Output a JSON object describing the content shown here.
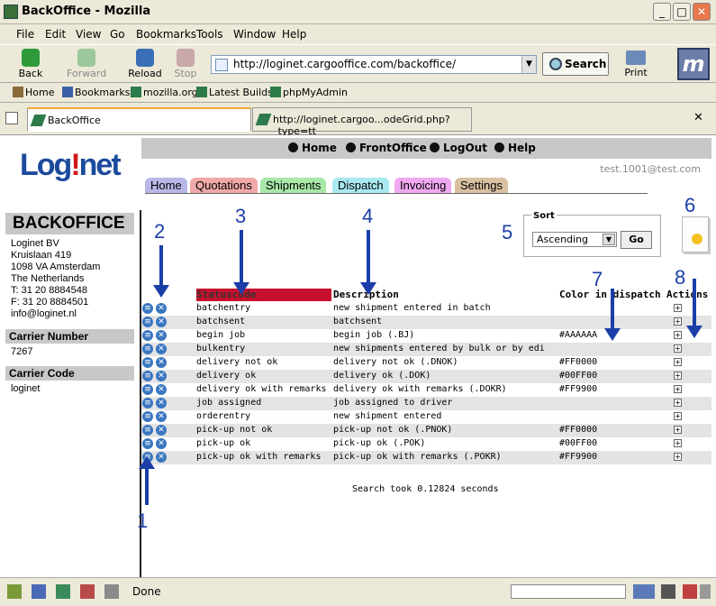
{
  "window": {
    "title": "BackOffice - Mozilla"
  },
  "menu": [
    "File",
    "Edit",
    "View",
    "Go",
    "Bookmarks",
    "Tools",
    "Window",
    "Help"
  ],
  "nav": {
    "back": "Back",
    "forward": "Forward",
    "reload": "Reload",
    "stop": "Stop",
    "print": "Print",
    "search": "Search",
    "url": "http://loginet.cargooffice.com/backoffice/"
  },
  "bookmarks": [
    "Home",
    "Bookmarks",
    "mozilla.org",
    "Latest Builds",
    "phpMyAdmin"
  ],
  "tabs": [
    "BackOffice",
    "http://loginet.cargoo...odeGrid.php?_type=tt"
  ],
  "status": {
    "text": "Done"
  },
  "app": {
    "logo_a": "Log",
    "logo_b": "!",
    "logo_c": "net",
    "topnav": [
      "Home",
      "FrontOffice",
      "LogOut",
      "Help"
    ],
    "email": "test.1001@test.com",
    "tabs": [
      {
        "label": "Home",
        "color": "#b8b8e8"
      },
      {
        "label": "Quotations",
        "color": "#f0a8a8"
      },
      {
        "label": "Shipments",
        "color": "#a8e8a8"
      },
      {
        "label": "Dispatch",
        "color": "#a8e8f0"
      },
      {
        "label": "Invoicing",
        "color": "#f0a8f0"
      },
      {
        "label": "Settings",
        "color": "#d8c0a0"
      }
    ],
    "backoffice": {
      "title": "BACKOFFICE",
      "address": [
        "Loginet BV",
        "Kruislaan 419",
        "1098 VA Amsterdam",
        "The Netherlands",
        "T: 31 20 8884548",
        "F: 31 20 8884501",
        "info@loginet.nl"
      ]
    },
    "carrier_number": {
      "label": "Carrier Number",
      "value": "7267"
    },
    "carrier_code": {
      "label": "Carrier Code",
      "value": "loginet"
    },
    "sort": {
      "legend": "Sort",
      "value": "Ascending",
      "go": "Go"
    },
    "grid": {
      "headers": {
        "status": "Statuscode",
        "desc": "Description",
        "color": "Color in dispatch",
        "actions": "Actions"
      },
      "rows": [
        [
          "batchentry",
          "new shipment entered in batch",
          ""
        ],
        [
          "batchsent",
          "batchsent",
          ""
        ],
        [
          "begin job",
          "begin job (.BJ)",
          "#AAAAAA"
        ],
        [
          "bulkentry",
          "new shipments entered by bulk or by edi",
          ""
        ],
        [
          "delivery not ok",
          "delivery not ok (.DNOK)",
          "#FF0000"
        ],
        [
          "delivery ok",
          "delivery ok (.DOK)",
          "#00FF00"
        ],
        [
          "delivery ok with remarks",
          "delivery ok with remarks (.DOKR)",
          "#FF9900"
        ],
        [
          "job assigned",
          "job assigned to driver",
          ""
        ],
        [
          "orderentry",
          "new shipment entered",
          ""
        ],
        [
          "pick-up not ok",
          "pick-up not ok (.PNOK)",
          "#FF0000"
        ],
        [
          "pick-up ok",
          "pick-up ok (.POK)",
          "#00FF00"
        ],
        [
          "pick-up ok with remarks",
          "pick-up ok with remarks (.POKR)",
          "#FF9900"
        ]
      ]
    },
    "search_took": "Search took 0.12824 seconds"
  },
  "annotations": [
    "1",
    "2",
    "3",
    "4",
    "5",
    "6",
    "7",
    "8"
  ]
}
